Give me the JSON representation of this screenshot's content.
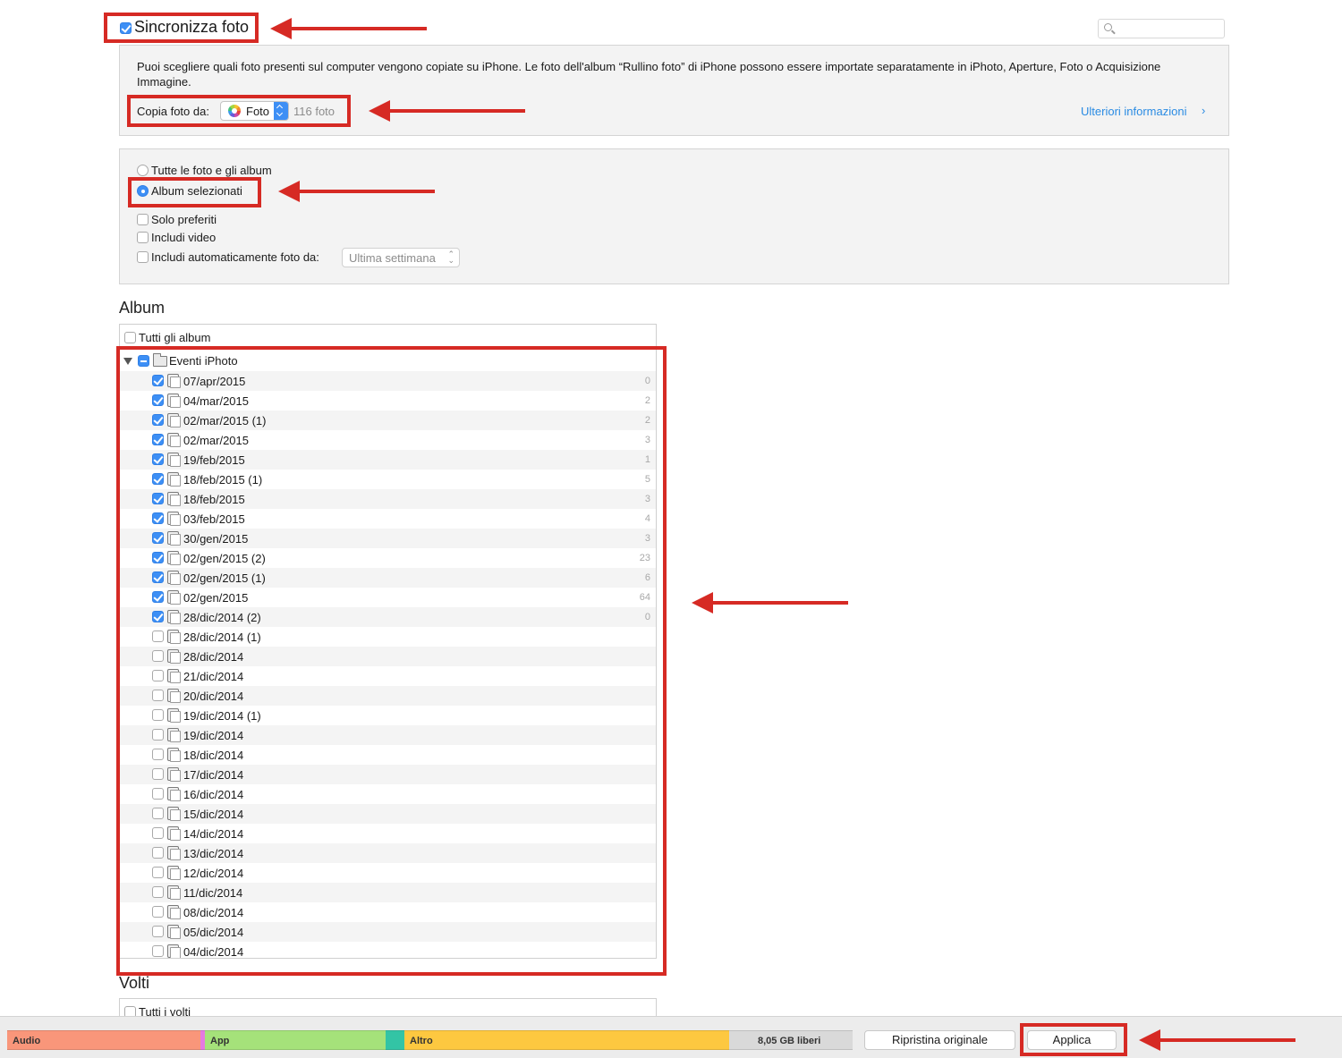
{
  "sync": {
    "label": "Sincronizza foto",
    "checked": true
  },
  "search": {
    "placeholder": ""
  },
  "info": {
    "text": "Puoi scegliere quali foto presenti sul computer vengono copiate su iPhone. Le foto dell'album “Rullino foto” di iPhone possono essere importate separatamente in iPhoto, Aperture, Foto o Acquisizione Immagine.",
    "copy_from_label": "Copia foto da:",
    "source_value": "Foto",
    "photo_count": "116 foto",
    "more_info": "Ulteriori informazioni"
  },
  "options": {
    "all_photos": "Tutte le foto e gli album",
    "selected_albums": "Album selezionati",
    "favorites_only": "Solo preferiti",
    "include_video": "Includi video",
    "auto_include": "Includi automaticamente foto da:",
    "auto_include_value": "Ultima settimana"
  },
  "albums": {
    "title": "Album",
    "all_albums": "Tutti gli album",
    "group": "Eventi iPhoto",
    "items": [
      {
        "name": "07/apr/2015",
        "count": "0",
        "checked": true
      },
      {
        "name": "04/mar/2015",
        "count": "2",
        "checked": true
      },
      {
        "name": "02/mar/2015 (1)",
        "count": "2",
        "checked": true
      },
      {
        "name": "02/mar/2015",
        "count": "3",
        "checked": true
      },
      {
        "name": "19/feb/2015",
        "count": "1",
        "checked": true
      },
      {
        "name": "18/feb/2015 (1)",
        "count": "5",
        "checked": true
      },
      {
        "name": "18/feb/2015",
        "count": "3",
        "checked": true
      },
      {
        "name": "03/feb/2015",
        "count": "4",
        "checked": true
      },
      {
        "name": "30/gen/2015",
        "count": "3",
        "checked": true
      },
      {
        "name": "02/gen/2015 (2)",
        "count": "23",
        "checked": true
      },
      {
        "name": "02/gen/2015 (1)",
        "count": "6",
        "checked": true
      },
      {
        "name": "02/gen/2015",
        "count": "64",
        "checked": true
      },
      {
        "name": "28/dic/2014 (2)",
        "count": "0",
        "checked": true
      },
      {
        "name": "28/dic/2014 (1)",
        "count": "",
        "checked": false
      },
      {
        "name": "28/dic/2014",
        "count": "",
        "checked": false
      },
      {
        "name": "21/dic/2014",
        "count": "",
        "checked": false
      },
      {
        "name": "20/dic/2014",
        "count": "",
        "checked": false
      },
      {
        "name": "19/dic/2014 (1)",
        "count": "",
        "checked": false
      },
      {
        "name": "19/dic/2014",
        "count": "",
        "checked": false
      },
      {
        "name": "18/dic/2014",
        "count": "",
        "checked": false
      },
      {
        "name": "17/dic/2014",
        "count": "",
        "checked": false
      },
      {
        "name": "16/dic/2014",
        "count": "",
        "checked": false
      },
      {
        "name": "15/dic/2014",
        "count": "",
        "checked": false
      },
      {
        "name": "14/dic/2014",
        "count": "",
        "checked": false
      },
      {
        "name": "13/dic/2014",
        "count": "",
        "checked": false
      },
      {
        "name": "12/dic/2014",
        "count": "",
        "checked": false
      },
      {
        "name": "11/dic/2014",
        "count": "",
        "checked": false
      },
      {
        "name": "08/dic/2014",
        "count": "",
        "checked": false
      },
      {
        "name": "05/dic/2014",
        "count": "",
        "checked": false
      },
      {
        "name": "04/dic/2014",
        "count": "",
        "checked": false
      }
    ]
  },
  "faces": {
    "title": "Volti",
    "all_faces": "Tutti i volti"
  },
  "capacity": [
    {
      "label": "Audio",
      "color": "#f9967a"
    },
    {
      "label": "",
      "color": "#e57ae0"
    },
    {
      "label": "App",
      "color": "#a5e27a"
    },
    {
      "label": "",
      "color": "#33c4a5"
    },
    {
      "label": "Altro",
      "color": "#fdc840"
    },
    {
      "label": "8,05 GB liberi",
      "color": "#d9d9d9"
    }
  ],
  "buttons": {
    "revert": "Ripristina originale",
    "apply": "Applica"
  },
  "annotation_color": "#d62a24"
}
